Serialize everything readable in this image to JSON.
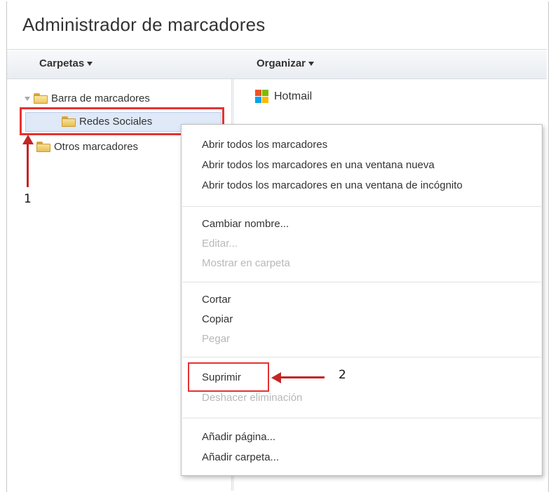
{
  "window": {
    "title": "Administrador de marcadores"
  },
  "columns": {
    "folders_label": "Carpetas",
    "organize_label": "Organizar"
  },
  "tree": {
    "items": [
      {
        "label": "Barra de marcadores"
      },
      {
        "label": "Redes Sociales"
      },
      {
        "label": "Otros marcadores"
      }
    ]
  },
  "list": {
    "items": [
      {
        "label": "Hotmail"
      }
    ]
  },
  "context_menu": {
    "groups": [
      [
        {
          "label": "Abrir todos los marcadores",
          "enabled": true
        },
        {
          "label": "Abrir todos los marcadores en una ventana nueva",
          "enabled": true
        },
        {
          "label": "Abrir todos los marcadores en una ventana de incógnito",
          "enabled": true
        }
      ],
      [
        {
          "label": "Cambiar nombre...",
          "enabled": true
        },
        {
          "label": "Editar...",
          "enabled": false
        },
        {
          "label": "Mostrar en carpeta",
          "enabled": false
        }
      ],
      [
        {
          "label": "Cortar",
          "enabled": true
        },
        {
          "label": "Copiar",
          "enabled": true
        },
        {
          "label": "Pegar",
          "enabled": false
        }
      ],
      [
        {
          "label": "Suprimir",
          "enabled": true
        },
        {
          "label": "Deshacer eliminación",
          "enabled": false
        }
      ],
      [
        {
          "label": "Añadir página...",
          "enabled": true
        },
        {
          "label": "Añadir carpeta...",
          "enabled": true
        }
      ]
    ]
  },
  "annotations": {
    "step1": "1",
    "step2": "2",
    "highlight_color": "#e53232"
  }
}
